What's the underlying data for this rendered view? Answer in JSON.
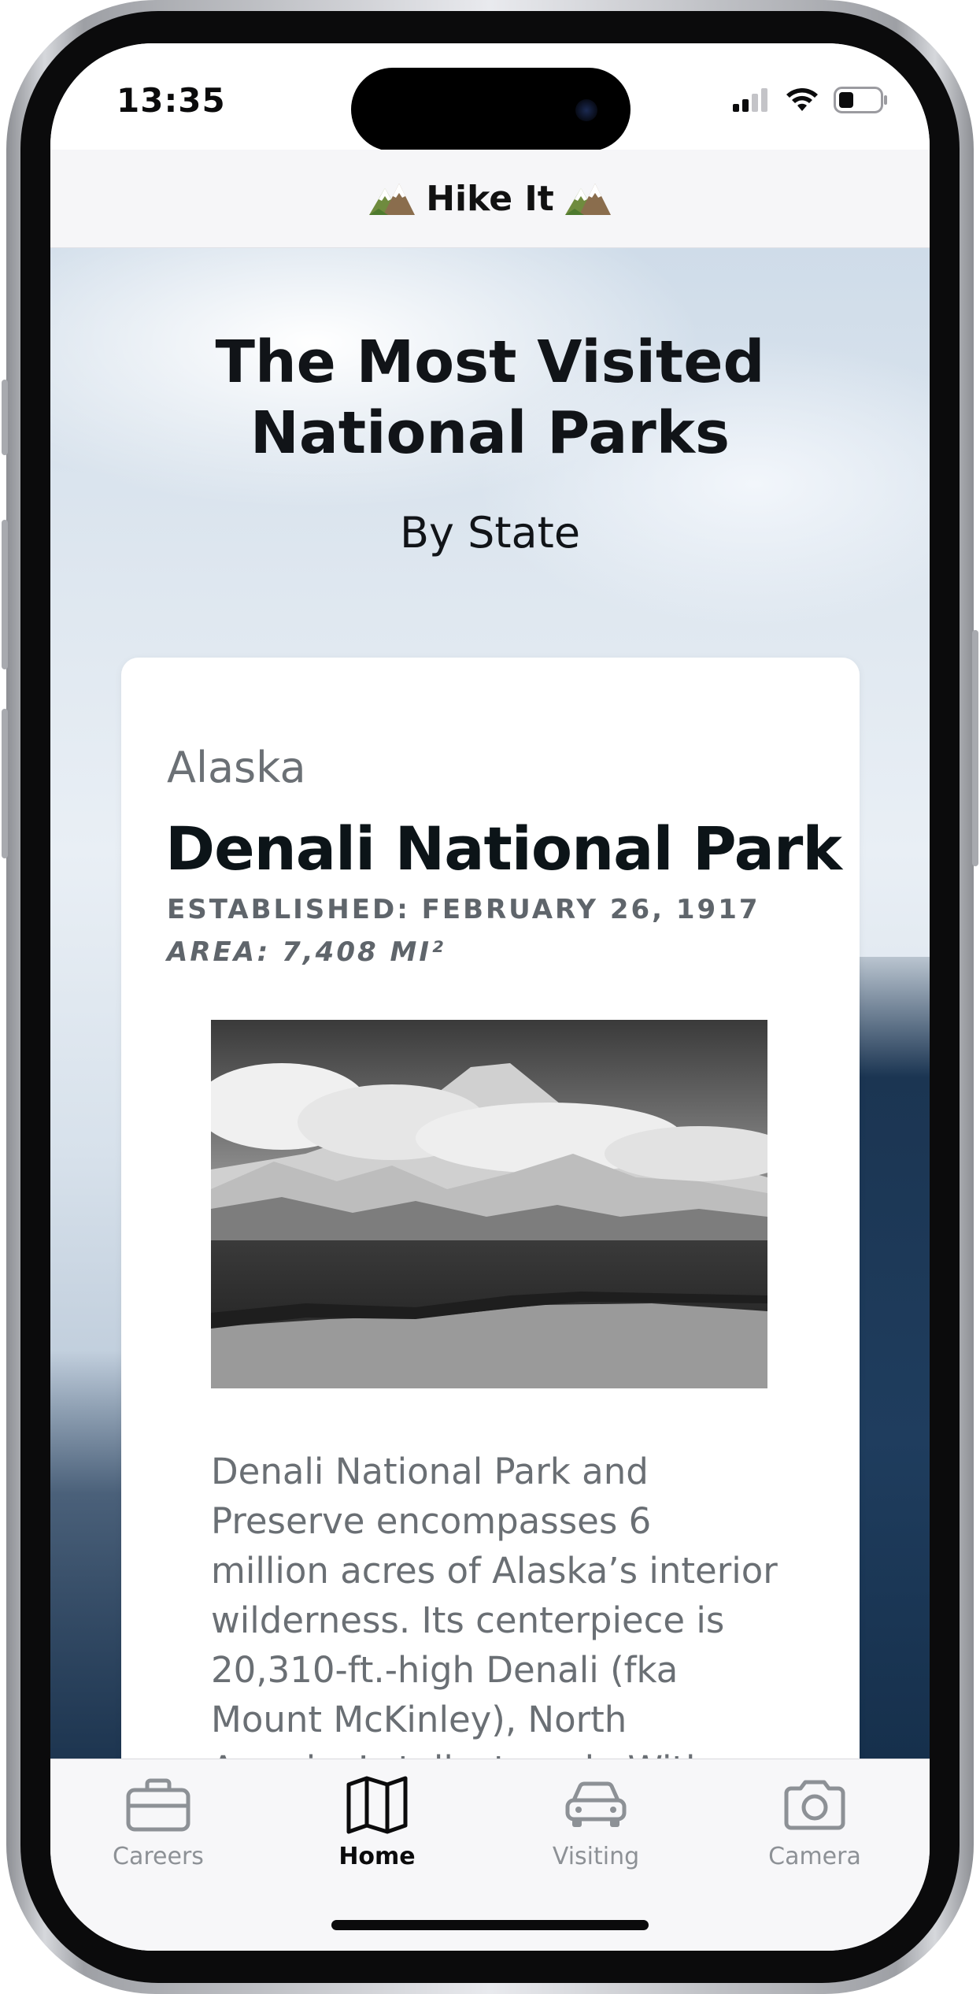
{
  "status_bar": {
    "time": "13:35",
    "icons": [
      "signal-icon",
      "wifi-icon",
      "battery-icon"
    ]
  },
  "header": {
    "title": "Hike It",
    "icon": "mountain-emoji-icon"
  },
  "page": {
    "title": "The Most Visited National Parks",
    "subtitle": "By State"
  },
  "card": {
    "state": "Alaska",
    "park_name": "Denali National Park",
    "established": "ESTABLISHED: FEBRUARY 26, 1917",
    "area": "AREA: 7,408 MI²",
    "image_alt": "Black and white photo of Denali mountain range",
    "description": "Denali National Park and Preserve encompasses 6 million acres of Alaska’s interior wilderness. Its centerpiece is 20,310-ft.-high Denali (fka Mount McKinley), North America’s tallest peak. With"
  },
  "tab_bar": {
    "tabs": [
      {
        "label": "Careers",
        "icon": "briefcase-icon",
        "active": false
      },
      {
        "label": "Home",
        "icon": "map-icon",
        "active": true
      },
      {
        "label": "Visiting",
        "icon": "car-icon",
        "active": false
      },
      {
        "label": "Camera",
        "icon": "camera-icon",
        "active": false
      }
    ]
  },
  "colors": {
    "accent": "#0b0b0c",
    "inactive_tab": "#8d9196",
    "card_text": "#6a6f74"
  }
}
